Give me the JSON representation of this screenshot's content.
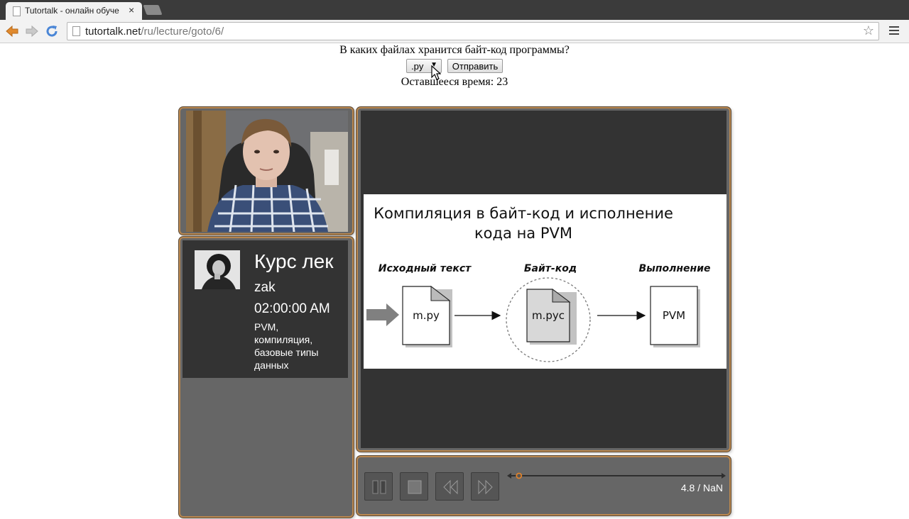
{
  "browser": {
    "tab_title": "Tutortalk - онлайн обуче",
    "tab_close": "×",
    "url_domain": "tutortalk.net",
    "url_path": "/ru/lecture/goto/6/"
  },
  "quiz": {
    "question": "В каких файлах хранится байт-код программы?",
    "selected_option": ".py",
    "submit_label": "Отправить",
    "timer_text": "Оставшееся время: 23"
  },
  "info": {
    "course_title": "Курс лек",
    "author": "zak",
    "time": "02:00:00 AM",
    "topics": "PVM, компиляция, базовые типы данных"
  },
  "slide": {
    "title_line1": "Компиляция в байт-код и исполнение",
    "title_line2": "кода на PVM",
    "source_label": "Исходный текст",
    "bytecode_label": "Байт-код",
    "exec_label": "Выполнение",
    "source_file": "m.py",
    "bytecode_file": "m.pyc",
    "exec_box": "PVM"
  },
  "player": {
    "time_readout": "4.8 / NaN",
    "progress": 0.03
  },
  "colors": {
    "panel_border": "#b8864e",
    "panel_bg": "#666666",
    "dark_bg": "#333333"
  }
}
